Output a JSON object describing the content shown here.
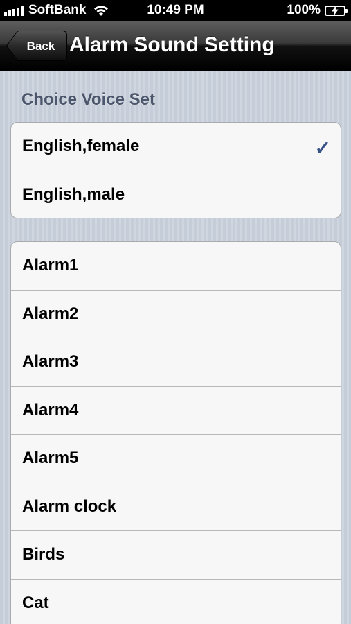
{
  "status_bar": {
    "carrier": "SoftBank",
    "time": "10:49 PM",
    "battery": "100%"
  },
  "nav": {
    "back_label": "Back",
    "title": "Alarm Sound Setting"
  },
  "voice_section": {
    "header": "Choice Voice Set",
    "items": [
      {
        "label": "English,female",
        "selected": true
      },
      {
        "label": "English,male",
        "selected": false
      }
    ]
  },
  "sounds": {
    "items": [
      {
        "label": "Alarm1"
      },
      {
        "label": "Alarm2"
      },
      {
        "label": "Alarm3"
      },
      {
        "label": "Alarm4"
      },
      {
        "label": "Alarm5"
      },
      {
        "label": "Alarm clock"
      },
      {
        "label": "Birds"
      },
      {
        "label": "Cat"
      }
    ]
  },
  "colors": {
    "checkmark": "#385487",
    "section_header": "#4c566c"
  }
}
